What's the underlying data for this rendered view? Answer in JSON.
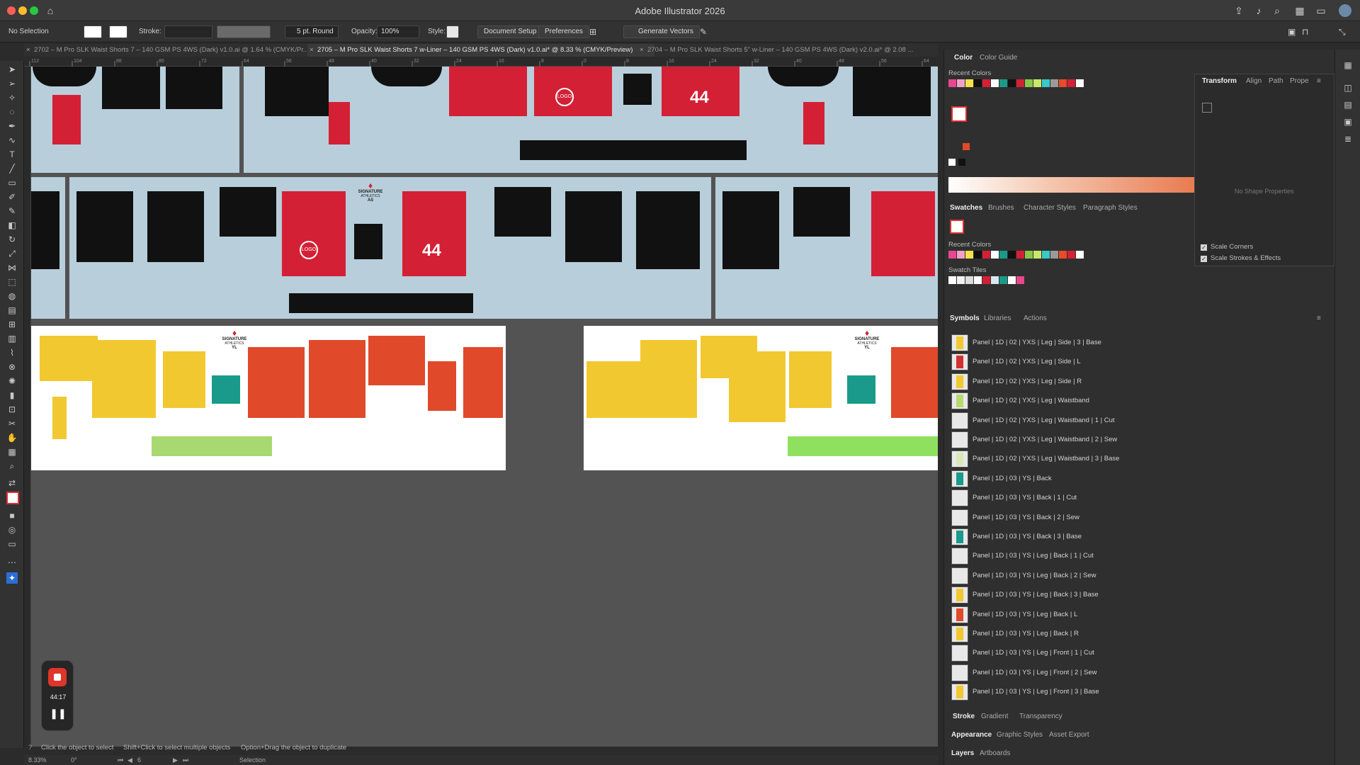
{
  "app": {
    "title": "Adobe Illustrator 2026"
  },
  "control_bar": {
    "selection": "No Selection",
    "stroke_label": "Stroke:",
    "brush_label": "5 pt. Round",
    "opacity_label": "Opacity:",
    "opacity_value": "100%",
    "style_label": "Style:",
    "document_setup": "Document Setup",
    "preferences": "Preferences",
    "generate_vectors": "Generate Vectors"
  },
  "doc_tabs": [
    {
      "label": "2702 – M Pro SLK Waist Shorts 7 – 140 GSM PS 4WS (Dark) v1.0.ai @ 1.64 % (CMYK/Pr...",
      "active": false
    },
    {
      "label": "2705 – M Pro SLK Waist Shorts 7 w-Liner – 140 GSM PS 4WS (Dark) v1.0.ai* @ 8.33 % (CMYK/Preview)",
      "active": true
    },
    {
      "label": "2704 – M Pro SLK Waist Shorts 5\" w-Liner – 140 GSM PS 4WS (Dark) v2.0.ai* @ 2.08 ...",
      "active": false
    }
  ],
  "ruler_ticks": [
    "112",
    "104",
    "88",
    "80",
    "72",
    "64",
    "56",
    "48",
    "40",
    "32",
    "24",
    "16",
    "8",
    "0",
    "8",
    "16",
    "24",
    "32",
    "40",
    "48",
    "56",
    "64"
  ],
  "artwork": {
    "brand_top": "SIGNATURE",
    "brand_bottom": "ATHLETICS",
    "logo_text": "LOGO",
    "number": "44",
    "size_tag_adult": "AS",
    "size_tag_youth": "YL"
  },
  "status": {
    "hint_1": "Click the object to select",
    "hint_2": "Shift+Click to select multiple objects",
    "hint_3": "Option+Drag the object to duplicate",
    "zoom": "8.33%",
    "rotation": "0°",
    "artboard_num": "6",
    "tool": "Selection"
  },
  "recorder": {
    "time": "44:17"
  },
  "color_panel": {
    "tabs": [
      "Color",
      "Color Guide"
    ],
    "recent_colors_label": "Recent Colors",
    "recent_colors": [
      "#e8468f",
      "#f2a0c8",
      "#f5e14a",
      "#111111",
      "#d42035",
      "#ffffff",
      "#1a9a8a",
      "#111111",
      "#d42035",
      "#88c84a",
      "#c8e86a",
      "#3ac8c8",
      "#9a9a9a",
      "#e84a2a",
      "#d42035",
      "#ffffff"
    ]
  },
  "swatches_panel": {
    "tabs": [
      "Swatches",
      "Brushes",
      "Character Styles",
      "Paragraph Styles"
    ],
    "recent_colors_label": "Recent Colors",
    "swatch_tiles_label": "Swatch Tiles"
  },
  "transform_panel": {
    "tabs": [
      "Transform",
      "Align",
      "Path",
      "Prope"
    ],
    "no_shape": "No Shape Properties",
    "scale_corners": "Scale Corners",
    "scale_strokes": "Scale Strokes & Effects"
  },
  "symbols_panel": {
    "tabs": [
      "Symbols",
      "Libraries",
      "Actions"
    ],
    "items": [
      {
        "label": "Panel | 1D | 02 | YXS | Leg | Side | 3 | Base",
        "thumb": "#f2c830"
      },
      {
        "label": "Panel | 1D | 02 | YXS | Leg | Side | L",
        "thumb": "#d43030"
      },
      {
        "label": "Panel | 1D | 02 | YXS | Leg | Side | R",
        "thumb": "#f2c830"
      },
      {
        "label": "Panel | 1D | 02 | YXS | Leg | Waistband",
        "thumb": "#b8d870"
      },
      {
        "label": "Panel | 1D | 02 | YXS | Leg | Waistband | 1 | Cut",
        "thumb": "#e8e8e8"
      },
      {
        "label": "Panel | 1D | 02 | YXS | Leg | Waistband | 2 | Sew",
        "thumb": "#e8e8e8"
      },
      {
        "label": "Panel | 1D | 02 | YXS | Leg | Waistband | 3 | Base",
        "thumb": "#d8e8b8"
      },
      {
        "label": "Panel | 1D | 03 | YS | Back",
        "thumb": "#1a9a8a"
      },
      {
        "label": "Panel | 1D | 03 | YS | Back | 1 | Cut",
        "thumb": "#e8e8e8"
      },
      {
        "label": "Panel | 1D | 03 | YS | Back | 2 | Sew",
        "thumb": "#e8e8e8"
      },
      {
        "label": "Panel | 1D | 03 | YS | Back | 3 | Base",
        "thumb": "#1a9a8a"
      },
      {
        "label": "Panel | 1D | 03 | YS | Leg | Back | 1 | Cut",
        "thumb": "#e8e8e8"
      },
      {
        "label": "Panel | 1D | 03 | YS | Leg | Back | 2 | Sew",
        "thumb": "#e8e8e8"
      },
      {
        "label": "Panel | 1D | 03 | YS | Leg | Back | 3 | Base",
        "thumb": "#f2c830"
      },
      {
        "label": "Panel | 1D | 03 | YS | Leg | Back | L",
        "thumb": "#e04a2a"
      },
      {
        "label": "Panel | 1D | 03 | YS | Leg | Back | R",
        "thumb": "#f2c830"
      },
      {
        "label": "Panel | 1D | 03 | YS | Leg | Front | 1 | Cut",
        "thumb": "#e8e8e8"
      },
      {
        "label": "Panel | 1D | 03 | YS | Leg | Front | 2 | Sew",
        "thumb": "#e8e8e8"
      },
      {
        "label": "Panel | 1D | 03 | YS | Leg | Front | 3 | Base",
        "thumb": "#f2c830"
      }
    ]
  },
  "bottom_panels": {
    "row1": [
      "Stroke",
      "Gradient",
      "Transparency"
    ],
    "row2": [
      "Appearance",
      "Graphic Styles",
      "Asset Export"
    ],
    "row3": [
      "Layers",
      "Artboards"
    ]
  }
}
